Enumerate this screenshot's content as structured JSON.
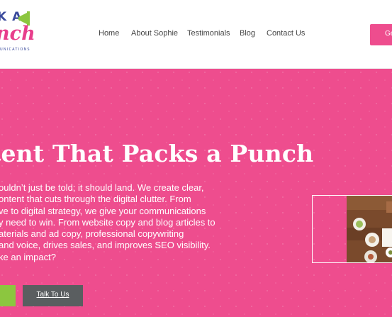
{
  "header": {
    "logo": {
      "line1": "K A",
      "line2": "nch",
      "line3": "UNICATIONS"
    },
    "nav": [
      {
        "label": "Home"
      },
      {
        "label": "About Sophie"
      },
      {
        "label": "Testimonials"
      },
      {
        "label": "Blog"
      },
      {
        "label": "Contact Us"
      }
    ],
    "cta_label": "Ge"
  },
  "hero": {
    "title": "tent That Packs a Punch",
    "body_lines": [
      "ouldn’t just be told; it should land. We create clear,",
      "ontent that cuts through the digital clutter. From",
      "ve to digital strategy, we give your communications",
      "y need to win. From website copy and blog articles to",
      "aterials and ad copy, professional copywriting",
      "and voice, drives sales, and improves SEO visibility.",
      "ke an impact?"
    ],
    "primary_button_label": "",
    "secondary_button_label": "Talk To Us"
  },
  "colors": {
    "hero_bg": "#ee4d8e",
    "logo_pink": "#e83e8c",
    "logo_blue": "#3a4a9c",
    "logo_green": "#8cc63f",
    "button_green": "#8cc63f",
    "button_grey": "#5a5e60"
  }
}
